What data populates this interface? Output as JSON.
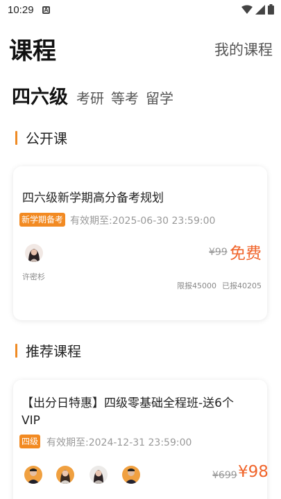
{
  "status_bar": {
    "time": "10:29",
    "notification_glyph": "A"
  },
  "header": {
    "title": "课程",
    "my_courses": "我的课程"
  },
  "tabs": [
    "四六级",
    "考研",
    "等考",
    "留学"
  ],
  "sections": {
    "public": "公开课",
    "recommended": "推荐课程"
  },
  "public_course": {
    "title": "四六级新学期高分备考规划",
    "tag": "新学期备考",
    "validity": "有效期至:2025-06-30 23:59:00",
    "teacher": "许密杉",
    "old_price": "¥99",
    "price": "免费",
    "limit": "限报45000",
    "enrolled": "已报40205"
  },
  "recommended_course": {
    "title_line1": "【出分日特惠】四级零基础全程班-送6个",
    "title_line2": "VIP",
    "tag": "四级",
    "validity": "有效期至:2024-12-31 23:59:00",
    "old_price": "¥699",
    "price": "¥98"
  },
  "colors": {
    "accent": "#ef8a24",
    "price": "#f0642a"
  }
}
